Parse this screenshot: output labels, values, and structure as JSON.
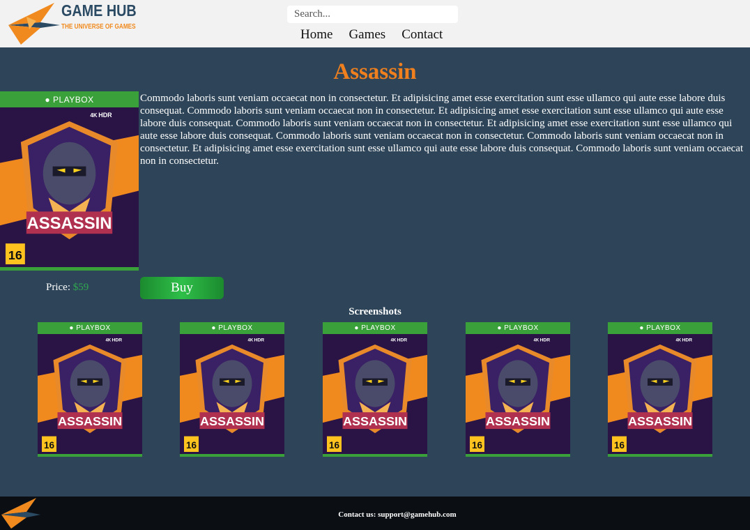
{
  "header": {
    "logo_title": "GAME HUB",
    "logo_subtitle": "THE UNIVERSE OF GAMES",
    "search_placeholder": "Search...",
    "nav": [
      "Home",
      "Games",
      "Contact"
    ]
  },
  "game": {
    "title": "Assassin",
    "cover_brand": "PLAYBOX",
    "cover_name": "ASSASSIN",
    "age_rating": "16",
    "cover_badge_4k": "4K",
    "cover_badge_hdr": "HDR",
    "description": "Commodo laboris sunt veniam occaecat non in consectetur. Et adipisicing amet esse exercitation sunt esse ullamco qui aute esse labore duis consequat. Commodo laboris sunt veniam occaecat non in consectetur. Et adipisicing amet esse exercitation sunt esse ullamco qui aute esse labore duis consequat. Commodo laboris sunt veniam occaecat non in consectetur. Et adipisicing amet esse exercitation sunt esse ullamco qui aute esse labore duis consequat. Commodo laboris sunt veniam occaecat non in consectetur. Commodo laboris sunt veniam occaecat non in consectetur. Et adipisicing amet esse exercitation sunt esse ullamco qui aute esse labore duis consequat. Commodo laboris sunt veniam occaecat non in consectetur.",
    "price_label": "Price:",
    "price_value": "$59",
    "buy_label": "Buy"
  },
  "screenshots": {
    "heading": "Screenshots",
    "count": 5
  },
  "footer": {
    "contact_text": "Contact us: support@gamehub.com"
  },
  "colors": {
    "page_bg": "#2e4559",
    "header_bg": "#f2f2f2",
    "accent_orange": "#f07f1e",
    "buy_green": "#2fbf49",
    "price_green": "#2fa84f",
    "footer_bg": "#0b0f14"
  },
  "icons": {
    "logo": "game-hub-jet-logo",
    "brand": "playbox-logo"
  }
}
